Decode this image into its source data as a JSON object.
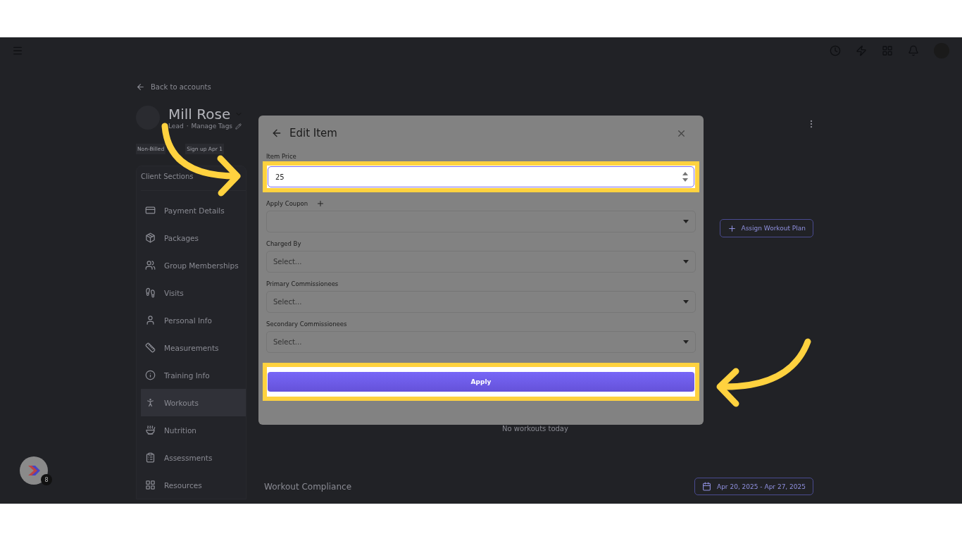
{
  "back_link": "Back to accounts",
  "profile": {
    "name": "Mill Rose",
    "status": "Lead",
    "separator": "·",
    "tags_link": "Manage Tags",
    "badges": [
      "Non-Billed",
      "Sign up Apr 1"
    ]
  },
  "sidebar": {
    "title": "Client Sections",
    "items": [
      {
        "label": "Payment Details",
        "selected": false
      },
      {
        "label": "Packages",
        "selected": false
      },
      {
        "label": "Group Memberships",
        "selected": false
      },
      {
        "label": "Visits",
        "selected": false
      },
      {
        "label": "Personal Info",
        "selected": false
      },
      {
        "label": "Measurements",
        "selected": false
      },
      {
        "label": "Training Info",
        "selected": false
      },
      {
        "label": "Workouts",
        "selected": true
      },
      {
        "label": "Nutrition",
        "selected": false
      },
      {
        "label": "Assessments",
        "selected": false
      },
      {
        "label": "Resources",
        "selected": false
      }
    ]
  },
  "main": {
    "assign_button": "Assign Workout Plan",
    "empty_text": "No workouts today",
    "compliance_title": "Workout Compliance",
    "date_range": "Apr 20, 2025 - Apr 27, 2025"
  },
  "modal": {
    "title": "Edit Item",
    "fields": [
      {
        "kind": "number",
        "label": "Item Price",
        "value": "25",
        "highlighted": true
      },
      {
        "kind": "select",
        "label": "Apply Coupon",
        "addable": true
      },
      {
        "kind": "select",
        "label": "Charged By",
        "placeholder": "Select..."
      },
      {
        "kind": "select",
        "label": "Primary Commissionees",
        "placeholder": "Select..."
      },
      {
        "kind": "select",
        "label": "Secondary Commissionees",
        "placeholder": "Select..."
      }
    ],
    "apply_button": {
      "label": "Apply",
      "highlighted": true
    }
  },
  "helper": {
    "badge": "8"
  }
}
